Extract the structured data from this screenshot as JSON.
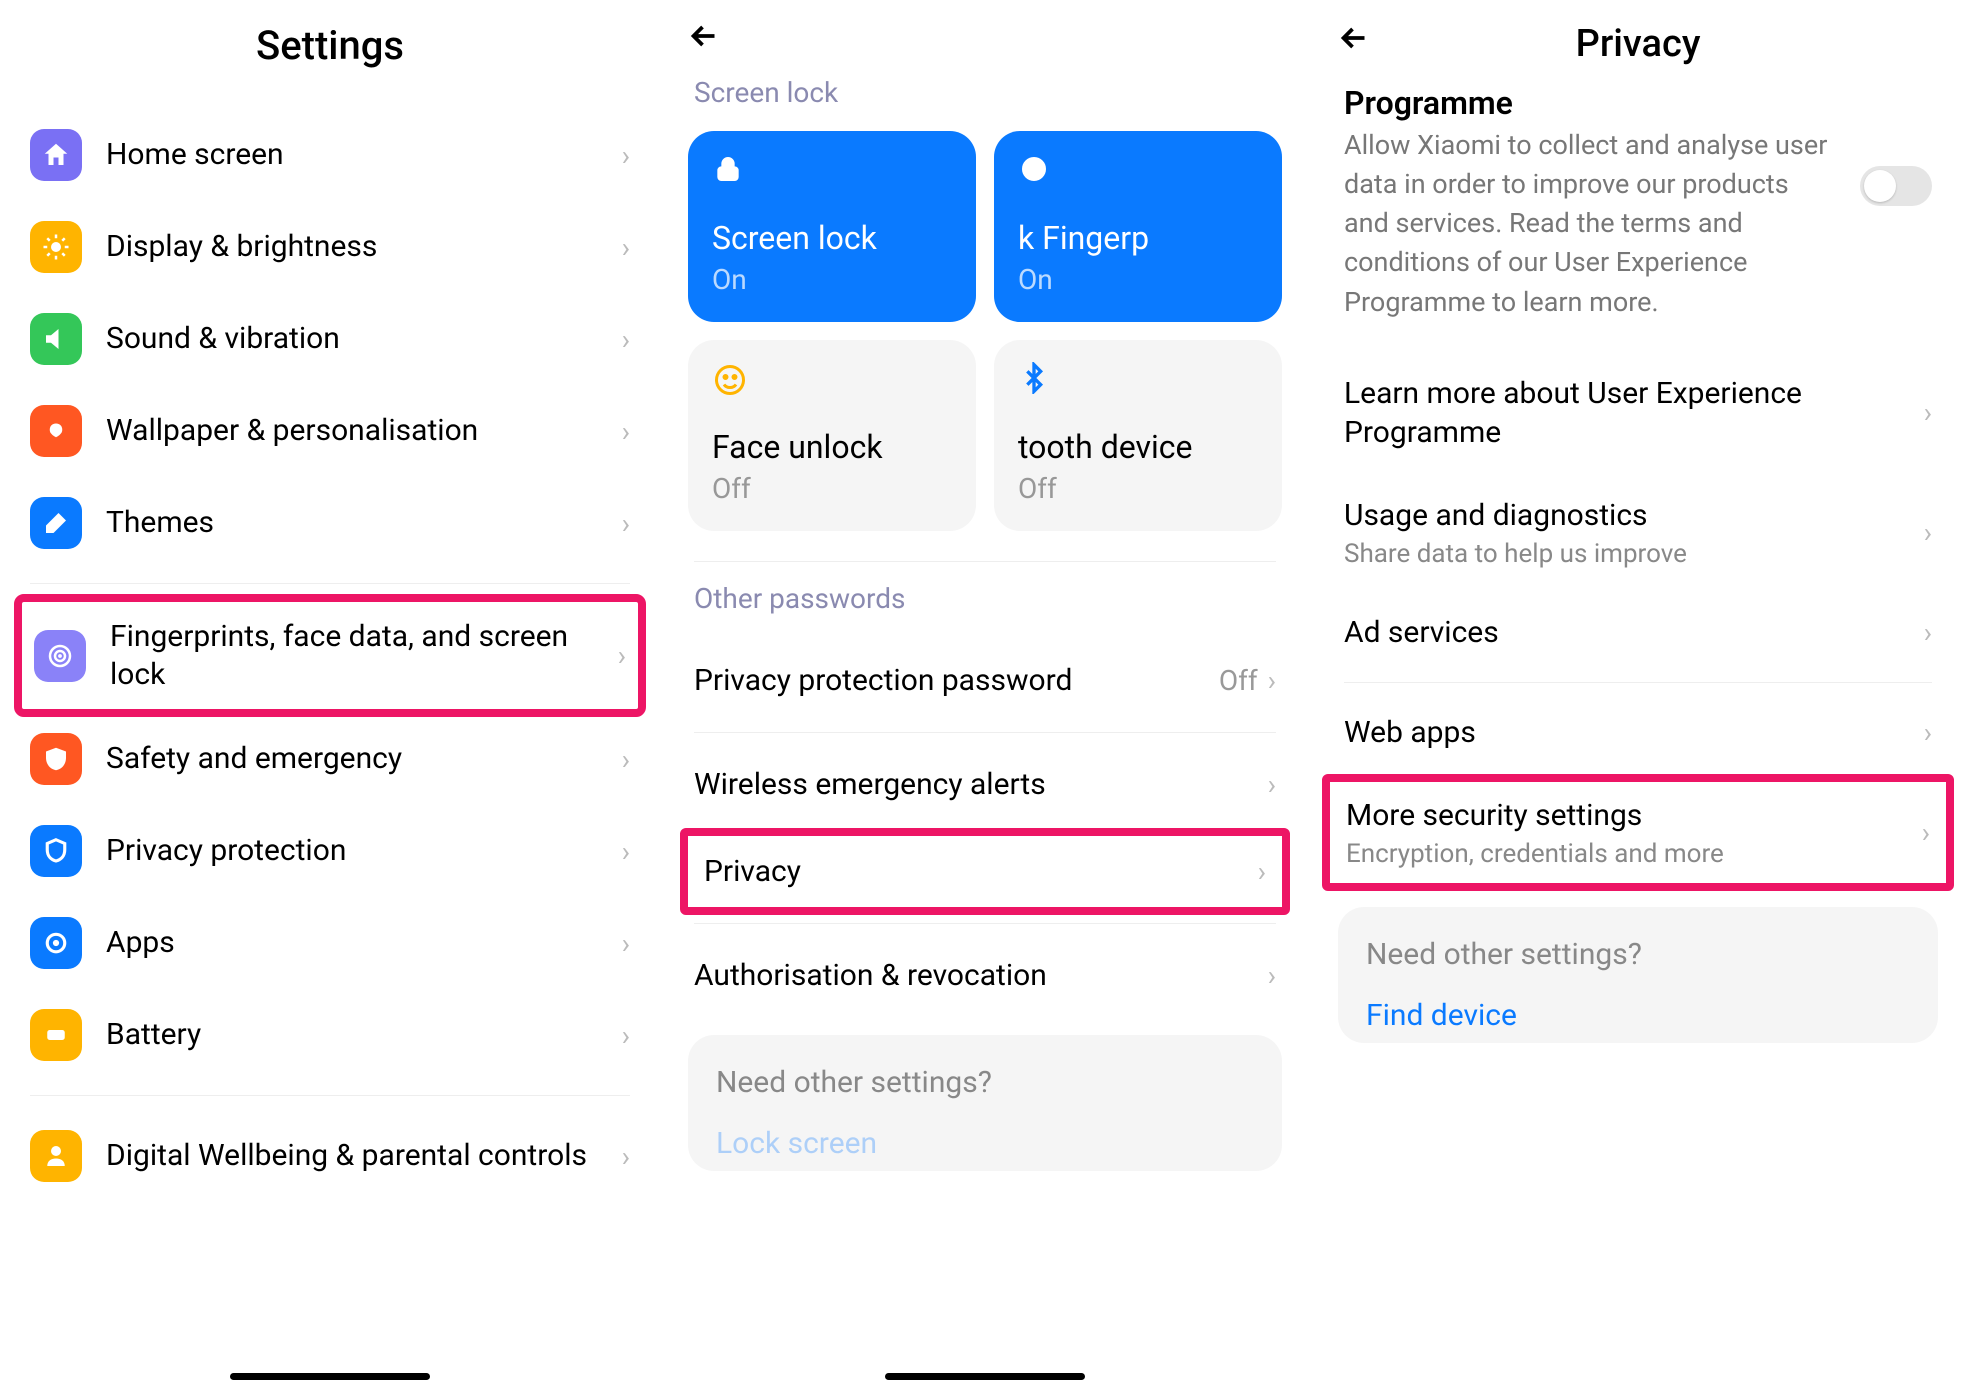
{
  "panel1": {
    "title": "Settings",
    "items": [
      {
        "label": "Home screen",
        "icon": "home",
        "color": "#7a70f4"
      },
      {
        "label": "Display & brightness",
        "icon": "brightness",
        "color": "#ffb400"
      },
      {
        "label": "Sound & vibration",
        "icon": "sound",
        "color": "#34c759"
      },
      {
        "label": "Wallpaper & personalisation",
        "icon": "wallpaper",
        "color": "#ff5722"
      },
      {
        "label": "Themes",
        "icon": "themes",
        "color": "#0a7aff"
      }
    ],
    "highlighted": {
      "label": "Fingerprints, face data, and screen lock",
      "icon": "fingerprint",
      "color": "#8a82f8"
    },
    "items2": [
      {
        "label": "Safety and emergency",
        "icon": "safety",
        "color": "#ff5722"
      },
      {
        "label": "Privacy protection",
        "icon": "privacy",
        "color": "#0a7aff"
      },
      {
        "label": "Apps",
        "icon": "apps",
        "color": "#0a7aff"
      },
      {
        "label": "Battery",
        "icon": "battery",
        "color": "#ffb400"
      }
    ],
    "items3": [
      {
        "label": "Digital Wellbeing & parental controls",
        "icon": "wellbeing",
        "color": "#ffb400"
      }
    ]
  },
  "panel2": {
    "section1_label": "Screen lock",
    "tiles": [
      {
        "title": "Screen lock",
        "sub": "On",
        "style": "blue",
        "icon": "lock"
      },
      {
        "title": "k        Fingerp",
        "sub": "On",
        "style": "blue",
        "icon": "fingerprint-outline"
      },
      {
        "title": "Face unlock",
        "sub": "Off",
        "style": "gray",
        "icon": "face"
      },
      {
        "title": "tooth device",
        "sub": "Off",
        "style": "gray",
        "icon": "bluetooth"
      }
    ],
    "section2_label": "Other passwords",
    "priv_pw_label": "Privacy protection password",
    "priv_pw_val": "Off",
    "rows": [
      {
        "label": "Wireless emergency alerts"
      }
    ],
    "highlighted": {
      "label": "Privacy"
    },
    "rows2": [
      {
        "label": "Authorisation & revocation"
      }
    ],
    "need_label": "Need other settings?",
    "need_link": "Lock screen"
  },
  "panel3": {
    "title": "Privacy",
    "prog_title": "Programme",
    "prog_desc": "Allow Xiaomi to collect and analyse user data in order to improve our products and services. Read the terms and conditions of our User Experience Programme to learn more.",
    "rows": [
      {
        "t1": "Learn more about User Experience Programme"
      },
      {
        "t1": "Usage and diagnostics",
        "t2": "Share data to help us improve"
      },
      {
        "t1": "Ad services"
      }
    ],
    "rows2": [
      {
        "t1": "Web apps"
      }
    ],
    "highlighted": {
      "t1": "More security settings",
      "t2": "Encryption, credentials and more"
    },
    "need_label": "Need other settings?",
    "need_link": "Find device"
  }
}
